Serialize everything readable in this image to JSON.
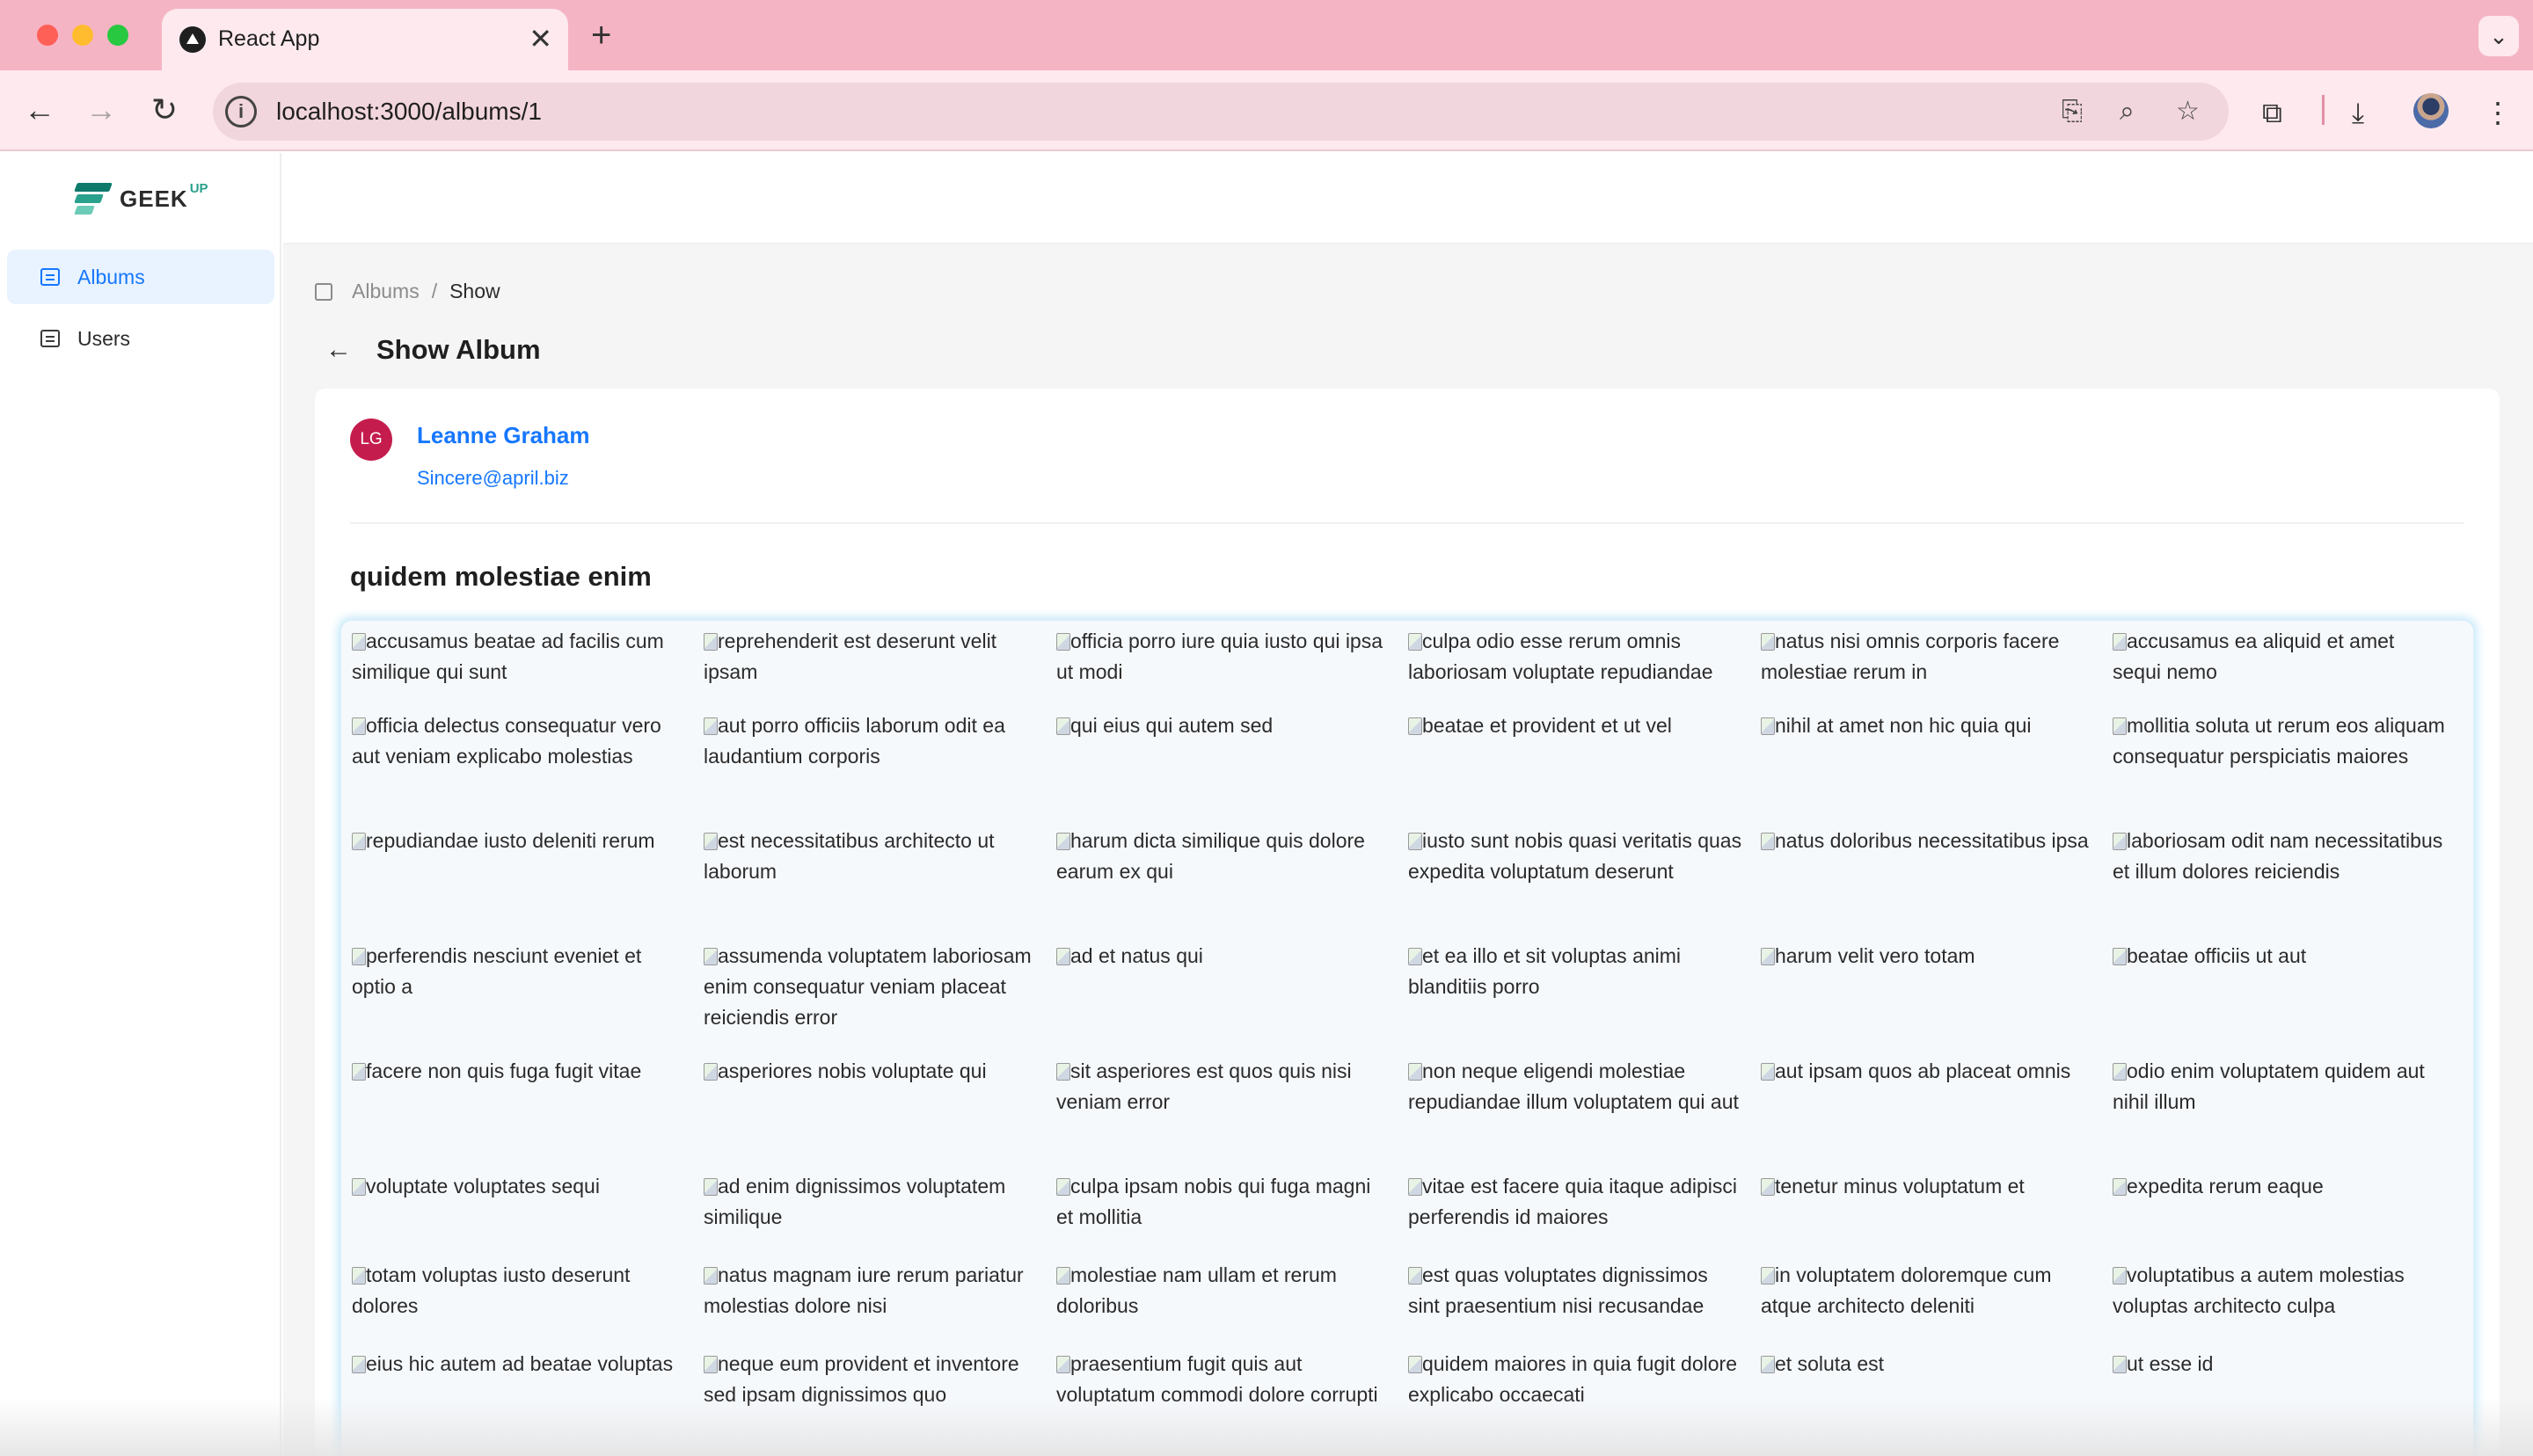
{
  "browser": {
    "tab_title": "React App",
    "close_glyph": "✕",
    "new_tab_glyph": "+",
    "tab_menu_glyph": "⌄",
    "url": "localhost:3000/albums/1",
    "info_glyph": "i",
    "icons": {
      "back": "←",
      "forward": "→",
      "reload": "↻",
      "translate": "⎘",
      "zoom": "⌕",
      "star": "☆",
      "extensions": "⧉",
      "download": "⤓",
      "menu": "⋮"
    }
  },
  "sidebar": {
    "logo_text": "GEEK",
    "logo_sup": "UP",
    "items": [
      {
        "label": "Albums",
        "icon": "album-list-icon",
        "active": true
      },
      {
        "label": "Users",
        "icon": "user-card-icon",
        "active": false
      }
    ]
  },
  "breadcrumb": {
    "parent": "Albums",
    "separator": "/",
    "current": "Show"
  },
  "page": {
    "back_glyph": "←",
    "title": "Show Album"
  },
  "user": {
    "initials": "LG",
    "name": "Leanne Graham",
    "email": "Sincere@april.biz",
    "avatar_color": "#c41d4d"
  },
  "album": {
    "title": "quidem molestiae enim",
    "photos": [
      "accusamus beatae ad facilis cum similique qui sunt",
      "reprehenderit est deserunt velit ipsam",
      "officia porro iure quia iusto qui ipsa ut modi",
      "culpa odio esse rerum omnis laboriosam voluptate repudiandae",
      "natus nisi omnis corporis facere molestiae rerum in",
      "accusamus ea aliquid et amet sequi nemo",
      "officia delectus consequatur vero aut veniam explicabo molestias",
      "aut porro officiis laborum odit ea laudantium corporis",
      "qui eius qui autem sed",
      "beatae et provident et ut vel",
      "nihil at amet non hic quia qui",
      "mollitia soluta ut rerum eos aliquam consequatur perspiciatis maiores",
      "repudiandae iusto deleniti rerum",
      "est necessitatibus architecto ut laborum",
      "harum dicta similique quis dolore earum ex qui",
      "iusto sunt nobis quasi veritatis quas expedita voluptatum deserunt",
      "natus doloribus necessitatibus ipsa",
      "laboriosam odit nam necessitatibus et illum dolores reiciendis",
      "perferendis nesciunt eveniet et optio a",
      "assumenda voluptatem laboriosam enim consequatur veniam placeat reiciendis error",
      "ad et natus qui",
      "et ea illo et sit voluptas animi blanditiis porro",
      "harum velit vero totam",
      "beatae officiis ut aut",
      "facere non quis fuga fugit vitae",
      "asperiores nobis voluptate qui",
      "sit asperiores est quos quis nisi veniam error",
      "non neque eligendi molestiae repudiandae illum voluptatem qui aut",
      "aut ipsam quos ab placeat omnis",
      "odio enim voluptatem quidem aut nihil illum",
      "voluptate voluptates sequi",
      "ad enim dignissimos voluptatem similique",
      "culpa ipsam nobis qui fuga magni et mollitia",
      "vitae est facere quia itaque adipisci perferendis id maiores",
      "tenetur minus voluptatum et",
      "expedita rerum eaque",
      "totam voluptas iusto deserunt dolores",
      "natus magnam iure rerum pariatur molestias dolore nisi",
      "molestiae nam ullam et rerum doloribus",
      "est quas voluptates dignissimos sint praesentium nisi recusandae",
      "in voluptatem doloremque cum atque architecto deleniti",
      "voluptatibus a autem molestias voluptas architecto culpa",
      "eius hic autem ad beatae voluptas",
      "neque eum provident et inventore sed ipsam dignissimos quo",
      "praesentium fugit quis aut voluptatum commodi dolore corrupti",
      "quidem maiores in quia fugit dolore explicabo occaecati",
      "et soluta est",
      "ut esse id"
    ]
  }
}
